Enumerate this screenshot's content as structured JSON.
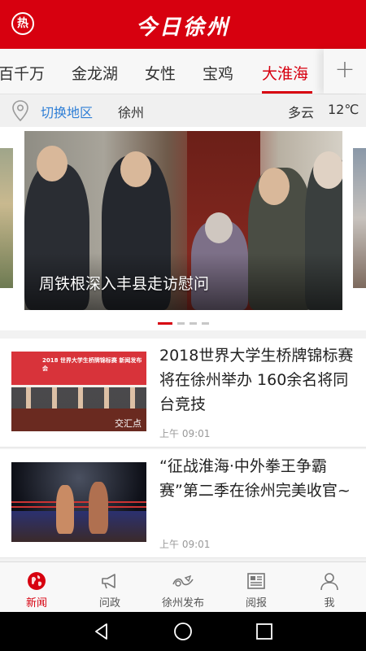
{
  "header": {
    "hot_label": "热",
    "logo_text": "今日徐州"
  },
  "tabs": {
    "items": [
      {
        "label": "百千万"
      },
      {
        "label": "金龙湖"
      },
      {
        "label": "女性"
      },
      {
        "label": "宝鸡"
      },
      {
        "label": "大淮海"
      }
    ],
    "active_index": 4,
    "add_label": "+"
  },
  "location": {
    "switch_label": "切换地区",
    "city": "徐州",
    "weather": "多云",
    "temperature": "12℃",
    "icon": "location-pin-icon"
  },
  "carousel": {
    "title": "周铁根深入丰县走访慰问",
    "slide_count": 4,
    "active_slide": 0
  },
  "news": [
    {
      "title": "2018世界大学生桥牌锦标赛将在徐州举办 160余名将同台竞技",
      "time": "上午 09:01",
      "thumb_banner": "2018 世界大学生桥牌锦标赛 新闻发布会",
      "thumb_overlay": "交汇点"
    },
    {
      "title": "“征战淮海·中外拳王争霸赛”第二季在徐州完美收官~",
      "time": "上午 09:01"
    }
  ],
  "bottom_tabs": {
    "items": [
      {
        "label": "新闻",
        "icon": "globe-icon"
      },
      {
        "label": "问政",
        "icon": "megaphone-icon"
      },
      {
        "label": "徐州发布",
        "icon": "publish-icon"
      },
      {
        "label": "阅报",
        "icon": "newspaper-icon"
      },
      {
        "label": "我",
        "icon": "user-icon"
      }
    ],
    "active_index": 0
  },
  "colors": {
    "brand": "#d7000f",
    "link": "#2f7fd6"
  }
}
